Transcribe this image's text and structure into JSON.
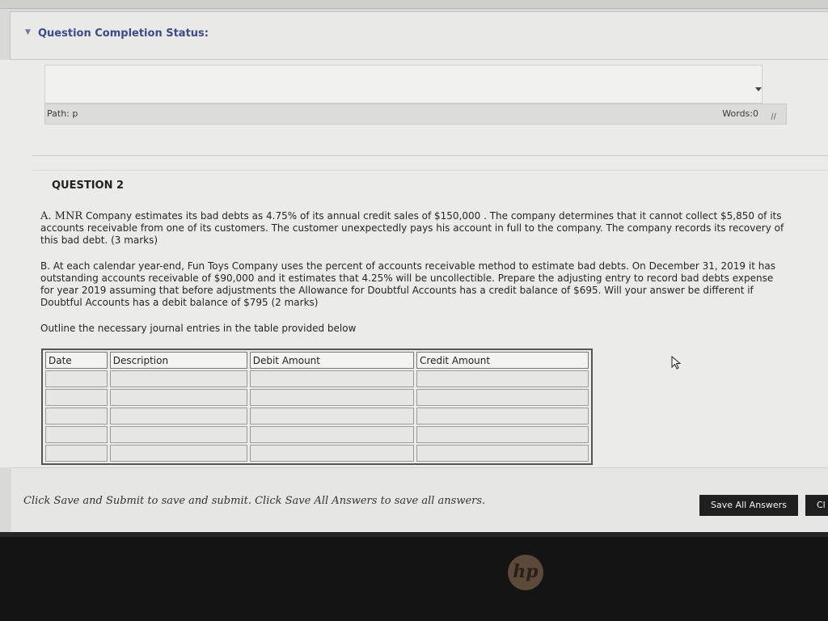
{
  "status": {
    "label": "Question Completion Status:",
    "chevron_icon": "chevron-down-icon"
  },
  "editor": {
    "path_label": "Path: p",
    "words_label": "Words:0"
  },
  "question": {
    "title": "QUESTION 2",
    "part_a_lead": "A. MNR",
    "part_a_text": " Company estimates its bad debts as 4.75% of its annual credit sales of $150,000 . The company  determines that it cannot collect $5,850 of its accounts receivable from one of its customers.  The customer unexpectedly pays his account in full to the company. The company records its recovery of this bad debt. (3 marks)",
    "part_b_text": "B. At each calendar year-end, Fun Toys Company uses the percent of accounts receivable method to estimate bad debts. On December 31, 2019 it has outstanding accounts receivable of $90,000 and it estimates that 4.25% will be uncollectible. Prepare the adjusting entry to record bad debts expense for year 2019 assuming that before adjustments the Allowance for Doubtful Accounts has a credit balance of $695. Will your answer be different if Doubtful Accounts has a debit balance of $795  (2 marks)",
    "instruction": "Outline the  necessary journal entries in the table provided below"
  },
  "journal_table": {
    "headers": [
      "Date",
      "Description",
      "Debit Amount",
      "Credit Amount"
    ],
    "rows": [
      [
        "",
        "",
        "",
        ""
      ],
      [
        "",
        "",
        "",
        ""
      ],
      [
        "",
        "",
        "",
        ""
      ],
      [
        "",
        "",
        "",
        ""
      ],
      [
        "",
        "",
        "",
        ""
      ]
    ]
  },
  "footer": {
    "instructions": "Click Save and Submit to save and submit. Click Save All Answers to save all answers.",
    "save_all_label": "Save All Answers",
    "submit_label_partial": "Cl"
  },
  "device": {
    "logo_text": "hp"
  }
}
